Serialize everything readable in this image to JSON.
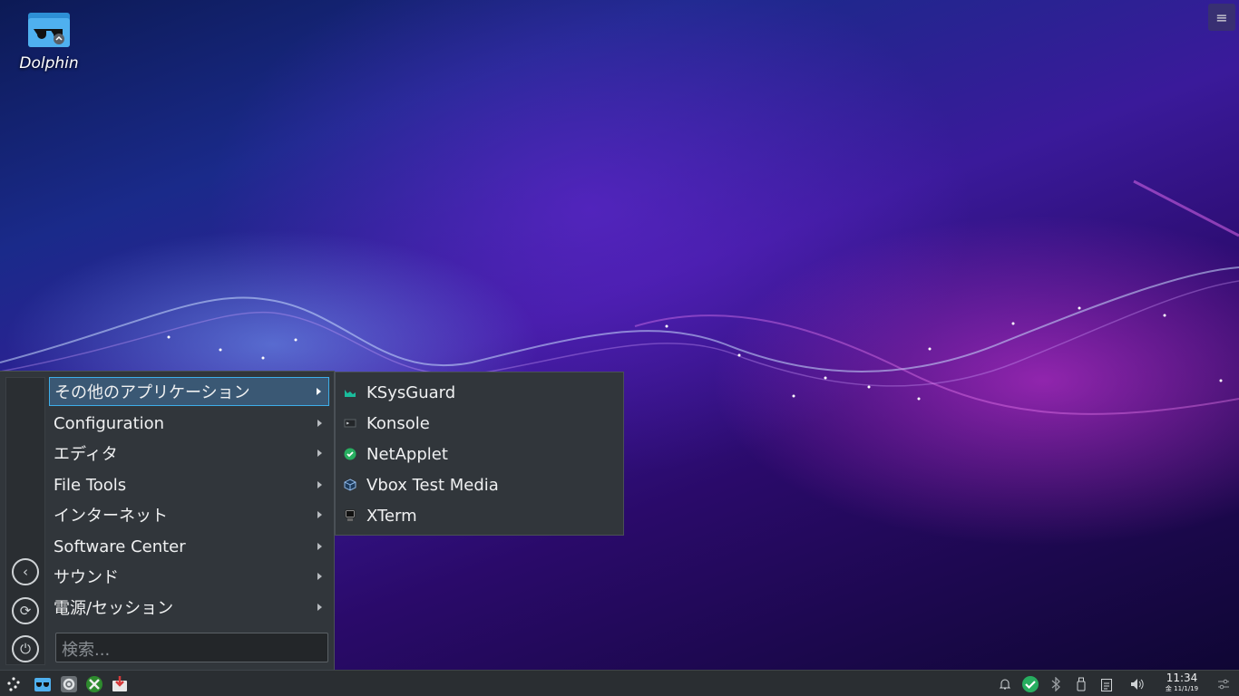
{
  "desktop": {
    "icons": [
      {
        "label": "Dolphin",
        "icon": "dolphin-folder-icon"
      }
    ],
    "corner_button_icon": "hamburger-menu-icon"
  },
  "app_menu": {
    "side_buttons": [
      "back-icon",
      "refresh-icon",
      "power-icon"
    ],
    "items": [
      {
        "label": "その他のアプリケーション",
        "active": true
      },
      {
        "label": "Configuration"
      },
      {
        "label": "エディタ"
      },
      {
        "label": "File Tools"
      },
      {
        "label": "インターネット"
      },
      {
        "label": "Software Center"
      },
      {
        "label": "サウンド"
      },
      {
        "label": "電源/セッション"
      }
    ],
    "search_placeholder": "検索..."
  },
  "submenu": {
    "items": [
      {
        "label": "KSysGuard",
        "icon": "ksysguard-icon"
      },
      {
        "label": "Konsole",
        "icon": "konsole-icon"
      },
      {
        "label": "NetApplet",
        "icon": "netapplet-check-icon"
      },
      {
        "label": "Vbox Test Media",
        "icon": "virtualbox-icon"
      },
      {
        "label": "XTerm",
        "icon": "xterm-icon"
      }
    ]
  },
  "taskbar": {
    "launchers": [
      "start-menu-icon",
      "dolphin-icon",
      "settings-icon",
      "xbox-app-icon",
      "installer-icon"
    ],
    "tray": [
      "notification-bell-icon",
      "network-check-icon",
      "bluetooth-icon",
      "usb-drive-icon",
      "clipboard-icon",
      "volume-icon"
    ],
    "clock": {
      "time": "11:34",
      "date": "金 11/1/19"
    }
  },
  "colors": {
    "accent": "#3daee9",
    "panel": "#31363b",
    "netapplet_green": "#27ae60"
  }
}
